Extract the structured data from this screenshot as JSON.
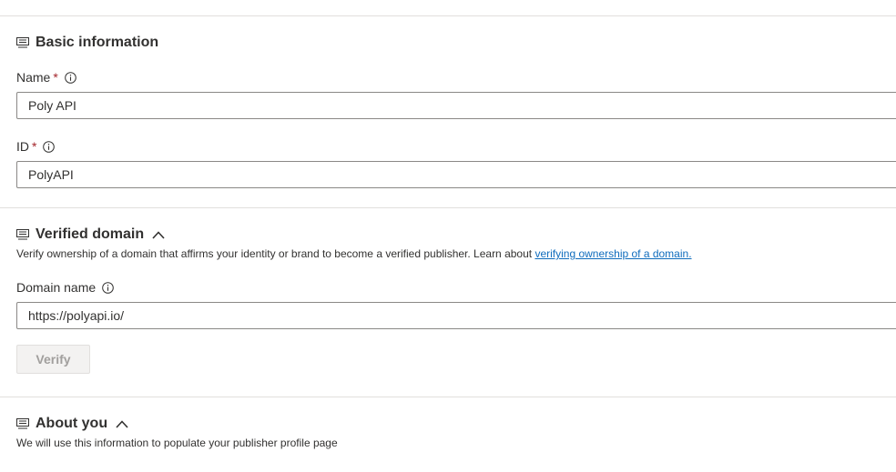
{
  "basic_info": {
    "title": "Basic information",
    "name_label": "Name",
    "name_value": "Poly API",
    "id_label": "ID",
    "id_value": "PolyAPI",
    "required_marker": "*"
  },
  "verified_domain": {
    "title": "Verified domain",
    "description": "Verify ownership of a domain that affirms your identity or brand to become a verified publisher. Learn about ",
    "link_text": "verifying ownership of a domain.",
    "domain_label": "Domain name",
    "domain_value": "https://polyapi.io/",
    "verify_label": "Verify"
  },
  "about_you": {
    "title": "About you",
    "description": "We will use this information to populate your publisher profile page"
  },
  "icons": {
    "section": "form-section-icon",
    "info": "info-circle-icon",
    "collapse": "chevron-up-icon"
  }
}
